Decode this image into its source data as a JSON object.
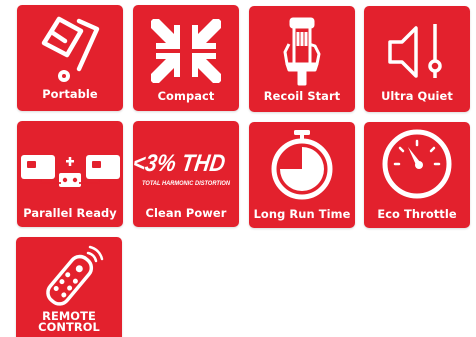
{
  "accent_color": "#e3212d",
  "icon_color": "#ffffff",
  "features": [
    {
      "label": "Portable",
      "icon": "hand-truck-icon"
    },
    {
      "label": "Compact",
      "icon": "compress-arrows-icon"
    },
    {
      "label": "Recoil Start",
      "icon": "recoil-handle-icon"
    },
    {
      "label": "Ultra Quiet",
      "icon": "speaker-volume-icon"
    },
    {
      "label": "Parallel Ready",
      "icon": "parallel-generators-icon"
    },
    {
      "label": "Clean Power",
      "icon": "thd-badge-icon",
      "badge_main": "<3% THD",
      "badge_sub": "TOTAL HARMONIC DISTORTION"
    },
    {
      "label": "Long Run Time",
      "icon": "stopwatch-icon"
    },
    {
      "label": "Eco Throttle",
      "icon": "gauge-icon"
    },
    {
      "label_line1": "REMOTE",
      "label_line2": "CONTROL",
      "icon": "remote-control-icon"
    }
  ]
}
